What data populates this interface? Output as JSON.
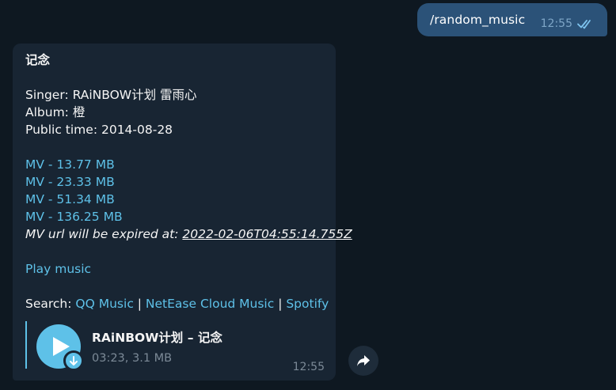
{
  "outgoing": {
    "text": "/random_music",
    "time": "12:55"
  },
  "incoming": {
    "title": "记念",
    "singer": "Singer: RAiNBOW计划 雷雨心",
    "album": "Album: 橙",
    "public_time": "Public time: 2014-08-28",
    "mv_links": [
      "MV - 13.77 MB",
      "MV - 23.33 MB",
      "MV - 51.34 MB",
      "MV - 136.25 MB"
    ],
    "expiry_label": "MV url will be expired at: ",
    "expiry_value": "2022-02-06T04:55:14.755Z",
    "play_link": "Play music",
    "search_label": "Search: ",
    "search_links": [
      "QQ Music",
      "NetEase Cloud Music",
      "Spotify"
    ],
    "separator": " | ",
    "audio": {
      "title": "RAiNBOW计划 – 记念",
      "meta": "03:23, 3.1 MB"
    },
    "time": "12:55"
  },
  "icons": {
    "read": "double-check-icon",
    "play": "play-icon",
    "download": "download-arrow-icon",
    "forward": "forward-arrow-icon"
  },
  "colors": {
    "background": "#0e1821",
    "outgoing_bubble": "#2b5278",
    "incoming_bubble": "#182533",
    "link": "#5ec1e8",
    "accent": "#5ec1e8"
  }
}
